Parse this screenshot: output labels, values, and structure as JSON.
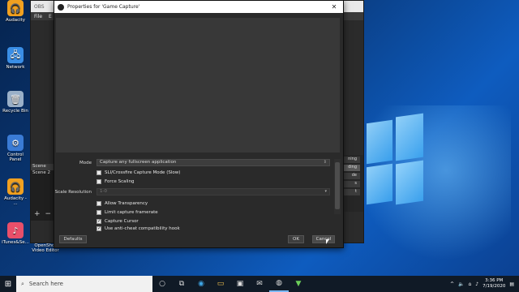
{
  "desktop": {
    "icons": [
      {
        "label": "Audacity",
        "glyph": "🎧",
        "color": "#f0a020"
      },
      {
        "label": "Network",
        "glyph": "🖧",
        "color": "#3a8ee6"
      },
      {
        "label": "Recycle Bin",
        "glyph": "🗑",
        "color": "#9ab0c8"
      },
      {
        "label": "Control Panel",
        "glyph": "⚙",
        "color": "#3a7bd5"
      },
      {
        "label": "Audacity - ...",
        "glyph": "🎧",
        "color": "#f0a020"
      },
      {
        "label": "iTunes&Se...",
        "glyph": "♪",
        "color": "#e84f6a"
      }
    ]
  },
  "obs": {
    "title": "OBS",
    "menu": [
      "File",
      "E"
    ],
    "scenes": [
      "Scene",
      "Scene 2"
    ],
    "scene_tools": [
      "+",
      "−"
    ],
    "right_buttons": [
      "ning",
      "ding",
      "de",
      "s",
      "t"
    ],
    "taskbar_item_label": "OpenShot Video Editor"
  },
  "dialog": {
    "title": "Properties for 'Game Capture'",
    "close_glyph": "✕",
    "mode_label": "Mode",
    "mode_value": "Capture any fullscreen application",
    "checkbox_sli": "SLI/Crossfire Capture Mode (Slow)",
    "checkbox_force": "Force Scaling",
    "scale_label": "Scale Resolution",
    "scale_value": "1-0",
    "checkbox_transparency": "Allow Transparency",
    "checkbox_limit": "Limit capture framerate",
    "checkbox_cursor": "Capture Cursor",
    "checkbox_anticheat": "Use anti-cheat compatibility hook",
    "defaults_label": "Defaults",
    "ok_label": "OK",
    "cancel_label": "Cancel",
    "checked": {
      "sli": false,
      "force": false,
      "transparency": false,
      "limit": false,
      "cursor": true,
      "anticheat": true
    }
  },
  "taskbar": {
    "search_placeholder": "Search here",
    "time": "3:36 PM",
    "date": "7/19/2020"
  }
}
